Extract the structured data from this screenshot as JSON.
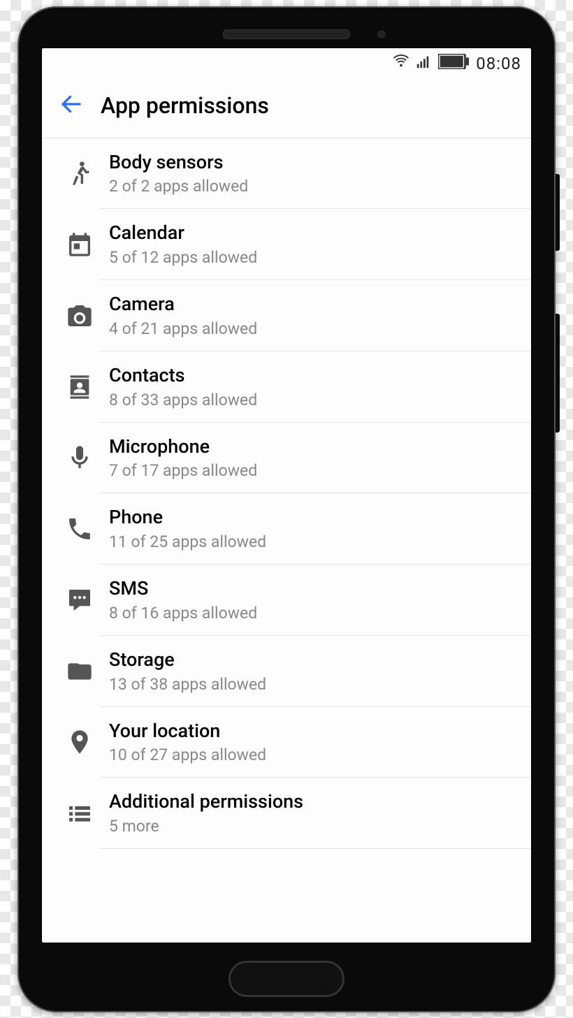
{
  "status": {
    "time": "08:08"
  },
  "header": {
    "title": "App permissions"
  },
  "permissions": [
    {
      "icon": "body-sensors-icon",
      "label": "Body sensors",
      "sub": "2 of 2 apps allowed"
    },
    {
      "icon": "calendar-icon",
      "label": "Calendar",
      "sub": "5 of 12 apps allowed"
    },
    {
      "icon": "camera-icon",
      "label": "Camera",
      "sub": "4 of 21 apps allowed"
    },
    {
      "icon": "contacts-icon",
      "label": "Contacts",
      "sub": "8 of 33 apps allowed"
    },
    {
      "icon": "microphone-icon",
      "label": "Microphone",
      "sub": "7 of 17 apps allowed"
    },
    {
      "icon": "phone-icon",
      "label": "Phone",
      "sub": "11 of 25 apps allowed"
    },
    {
      "icon": "sms-icon",
      "label": "SMS",
      "sub": "8 of 16 apps allowed"
    },
    {
      "icon": "storage-icon",
      "label": "Storage",
      "sub": "13 of 38 apps allowed"
    },
    {
      "icon": "location-icon",
      "label": "Your location",
      "sub": "10 of 27 apps allowed"
    },
    {
      "icon": "list-icon",
      "label": "Additional permissions",
      "sub": "5 more"
    }
  ]
}
